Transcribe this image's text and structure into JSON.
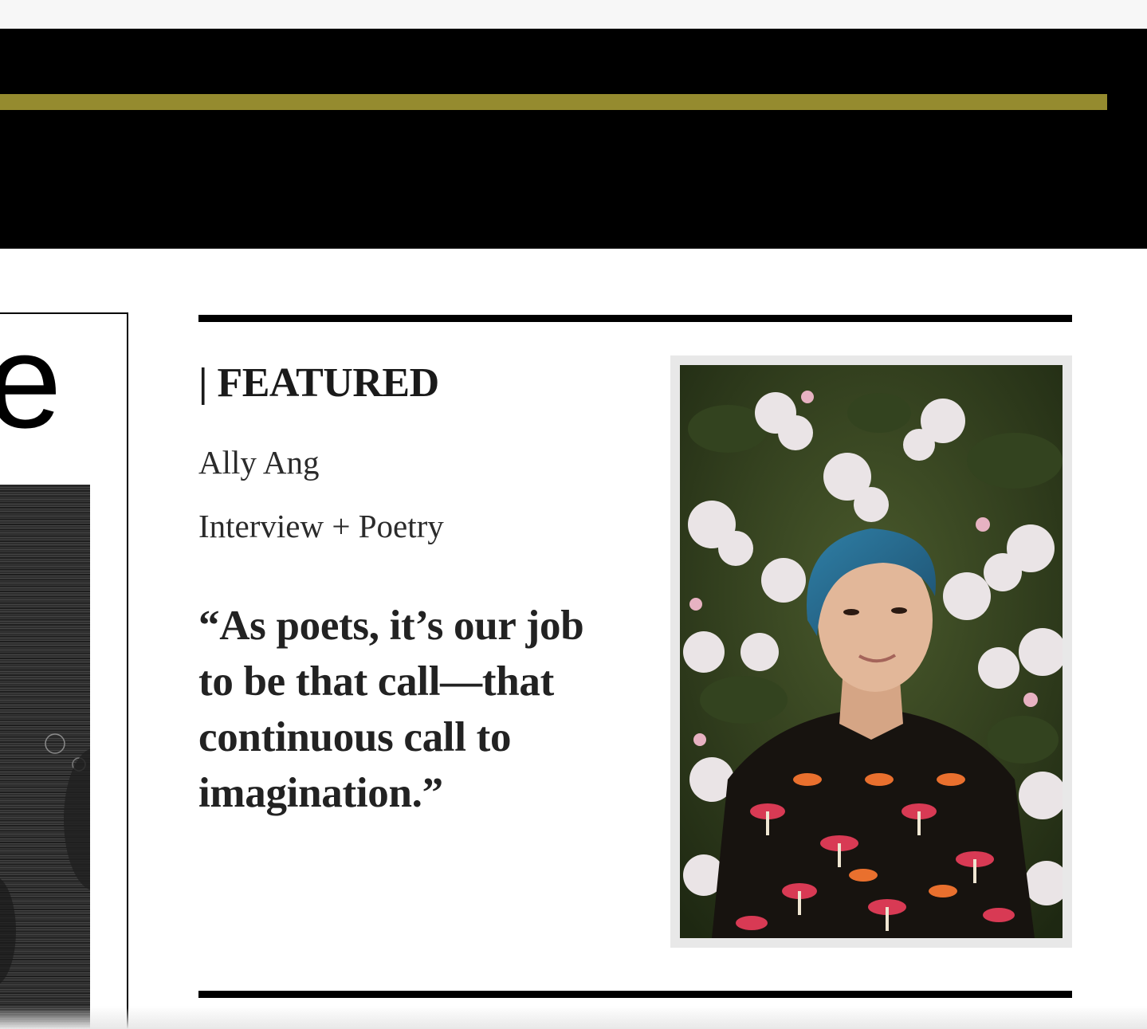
{
  "colors": {
    "header_background": "#000000",
    "accent_rule": "#958b2f",
    "text": "#1a1a1a",
    "photo_frame": "#e8e8e8"
  },
  "cover": {
    "letter": "e",
    "image_alt": "magazine-cover-art"
  },
  "featured": {
    "heading": "| FEATURED",
    "author": "Ally Ang",
    "category": "Interview + Poetry",
    "quote": "“As poets, it’s our job to be that call—that continuous call to imagination.”"
  },
  "photo": {
    "subject": "portrait-photo"
  }
}
